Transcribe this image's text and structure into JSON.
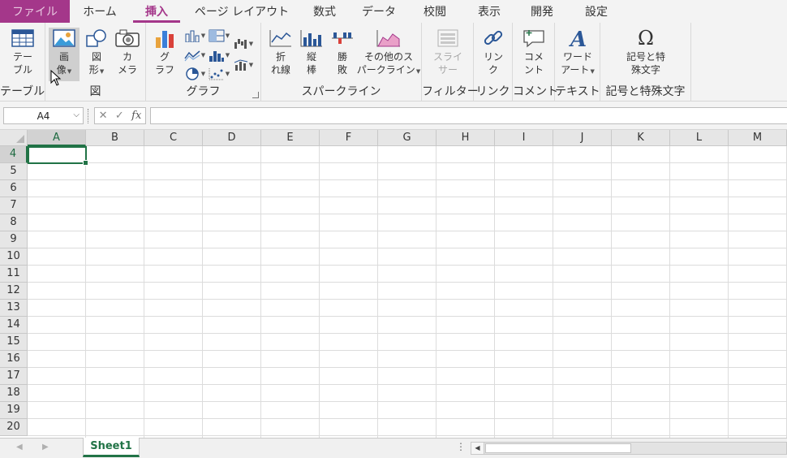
{
  "tabs": [
    {
      "label": "ファイル",
      "key": "file"
    },
    {
      "label": "ホーム",
      "key": "home"
    },
    {
      "label": "挿入",
      "key": "insert"
    },
    {
      "label": "ページ レイアウト",
      "key": "page-layout"
    },
    {
      "label": "数式",
      "key": "formulas"
    },
    {
      "label": "データ",
      "key": "data"
    },
    {
      "label": "校閲",
      "key": "review"
    },
    {
      "label": "表示",
      "key": "view"
    },
    {
      "label": "開発",
      "key": "developer"
    },
    {
      "label": "設定",
      "key": "settings"
    }
  ],
  "active_tab": "挿入",
  "ribbon": {
    "table": {
      "group_label": "テーブル",
      "table_btn": [
        "テー",
        "ブル"
      ]
    },
    "illustrations": {
      "group_label": "図",
      "picture_btn": [
        "画",
        "像"
      ],
      "shapes_btn": [
        "図",
        "形"
      ],
      "camera_btn": [
        "カ",
        "メラ"
      ]
    },
    "charts": {
      "group_label": "グラフ",
      "chart_btn": [
        "グ",
        "ラフ"
      ]
    },
    "sparklines": {
      "group_label": "スパークライン",
      "line_btn": [
        "折",
        "れ線"
      ],
      "column_btn": [
        "縦",
        "棒"
      ],
      "winloss_btn": [
        "勝",
        "敗"
      ],
      "other_btn": [
        "その他のス",
        "パークライン"
      ]
    },
    "filters": {
      "group_label": "フィルター",
      "slicer_btn": [
        "スライ",
        "サー"
      ]
    },
    "links": {
      "group_label": "リンク",
      "link_btn": [
        "リン",
        "ク"
      ]
    },
    "comments": {
      "group_label": "コメント",
      "comment_btn": [
        "コメ",
        "ント"
      ]
    },
    "text": {
      "group_label": "テキスト",
      "wordart_btn": [
        "ワード",
        "アート"
      ]
    },
    "symbols": {
      "group_label": "記号と特殊文字",
      "symbol_btn": [
        "記号と特",
        "殊文字"
      ],
      "omega": "Ω"
    }
  },
  "formula_bar": {
    "name_box": "A4",
    "cancel": "✕",
    "enter": "✓",
    "fx": "fx",
    "content": ""
  },
  "columns": [
    "A",
    "B",
    "C",
    "D",
    "E",
    "F",
    "G",
    "H",
    "I",
    "J",
    "K",
    "L",
    "M"
  ],
  "rows": [
    "4",
    "5",
    "6",
    "7",
    "8",
    "9",
    "10",
    "11",
    "12",
    "13",
    "14",
    "15",
    "16",
    "17",
    "18",
    "19",
    "20"
  ],
  "active_cell": "A4",
  "sheet_tabs": [
    "Sheet1"
  ],
  "active_sheet": "Sheet1",
  "colors": {
    "insert_accent": "#a4378a",
    "excel_green": "#217346",
    "ribbon_bg": "#f3f3f3"
  }
}
